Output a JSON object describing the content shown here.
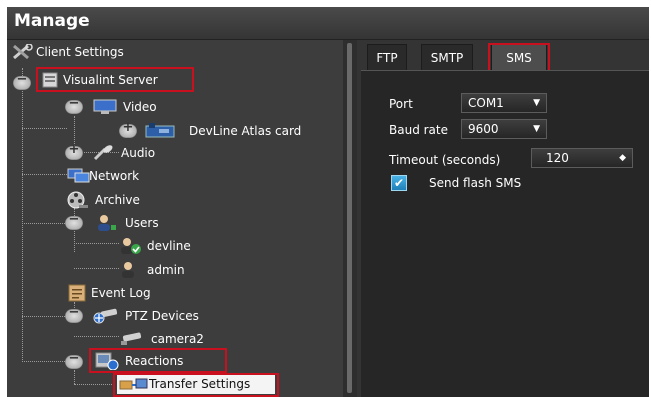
{
  "window": {
    "title": "Manage"
  },
  "tree": {
    "client_settings": "Client Settings",
    "server": "Visualint Server",
    "video": "Video",
    "devline_card": "DevLine Atlas card",
    "audio": "Audio",
    "network": "Network",
    "archive": "Archive",
    "users": "Users",
    "user_devline": "devline",
    "user_admin": "admin",
    "event_log": "Event Log",
    "ptz_devices": "PTZ Devices",
    "camera2": "camera2",
    "reactions": "Reactions",
    "transfer_settings": "Transfer Settings",
    "toggle_minus": "−",
    "toggle_plus": "+"
  },
  "tabs": [
    {
      "label": "FTP"
    },
    {
      "label": "SMTP"
    },
    {
      "label": "SMS",
      "active": true
    }
  ],
  "sms": {
    "port_label": "Port",
    "port_value": "COM1",
    "baud_label": "Baud rate",
    "baud_value": "9600",
    "timeout_label": "Timeout (seconds)",
    "timeout_value": "120",
    "flash_label": "Send flash SMS",
    "flash_checked": true,
    "check_mark": "✔",
    "dropdown_arrow": "▼",
    "spin_arrows": "◆"
  },
  "colors": {
    "highlight": "#c8101e",
    "checkbox": "#2a90cc"
  }
}
